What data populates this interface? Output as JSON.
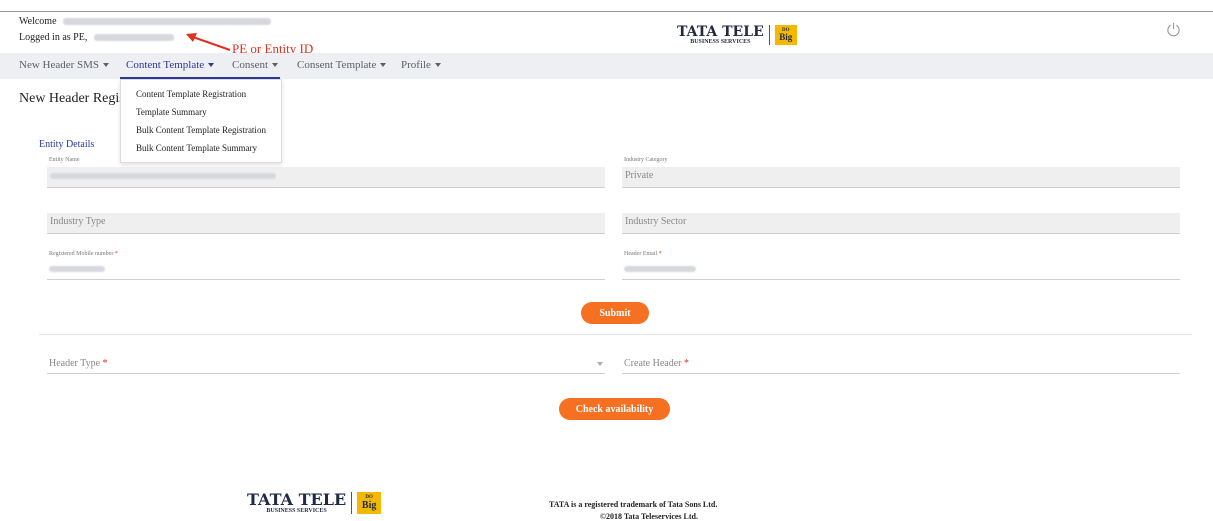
{
  "header": {
    "welcome_label": "Welcome",
    "logged_in_label": "Logged in as PE,",
    "annotation": "PE or Entity ID",
    "logo": {
      "name": "TATA TELE",
      "tagline": "BUSINESS SERVICES",
      "badge_top": "DO",
      "badge_bottom": "Big"
    }
  },
  "nav": {
    "items": [
      {
        "label": "New Header SMS"
      },
      {
        "label": "Content Template"
      },
      {
        "label": "Consent"
      },
      {
        "label": "Consent Template"
      },
      {
        "label": "Profile"
      }
    ],
    "active_index": 1
  },
  "dropdown": {
    "items": [
      {
        "label": "Content Template Registration"
      },
      {
        "label": "Template Summary"
      },
      {
        "label": "Bulk Content Template Registration"
      },
      {
        "label": "Bulk Content Template Summary"
      }
    ]
  },
  "page": {
    "title": "New Header Registr",
    "section_title": "Entity Details"
  },
  "form": {
    "entity_name_label": "Entity Name",
    "industry_category_label": "Industry Category",
    "industry_category_value": "Private",
    "industry_type_placeholder": "Industry Type",
    "industry_sector_placeholder": "Industry Sector",
    "mobile_label": "Registered Mobile number",
    "email_label": "Header Email",
    "submit_label": "Submit",
    "header_type_label": "Header Type",
    "create_header_label": "Create Header",
    "check_label": "Check availability"
  },
  "footer": {
    "trademark": "TATA is a registered trademark of Tata Sons Ltd.",
    "copyright": "©2018 Tata Teleservices Ltd."
  },
  "colors": {
    "accent": "#f57020",
    "nav_active": "#2b3a9a",
    "annotation": "#e0301e",
    "badge": "#f5b800"
  }
}
